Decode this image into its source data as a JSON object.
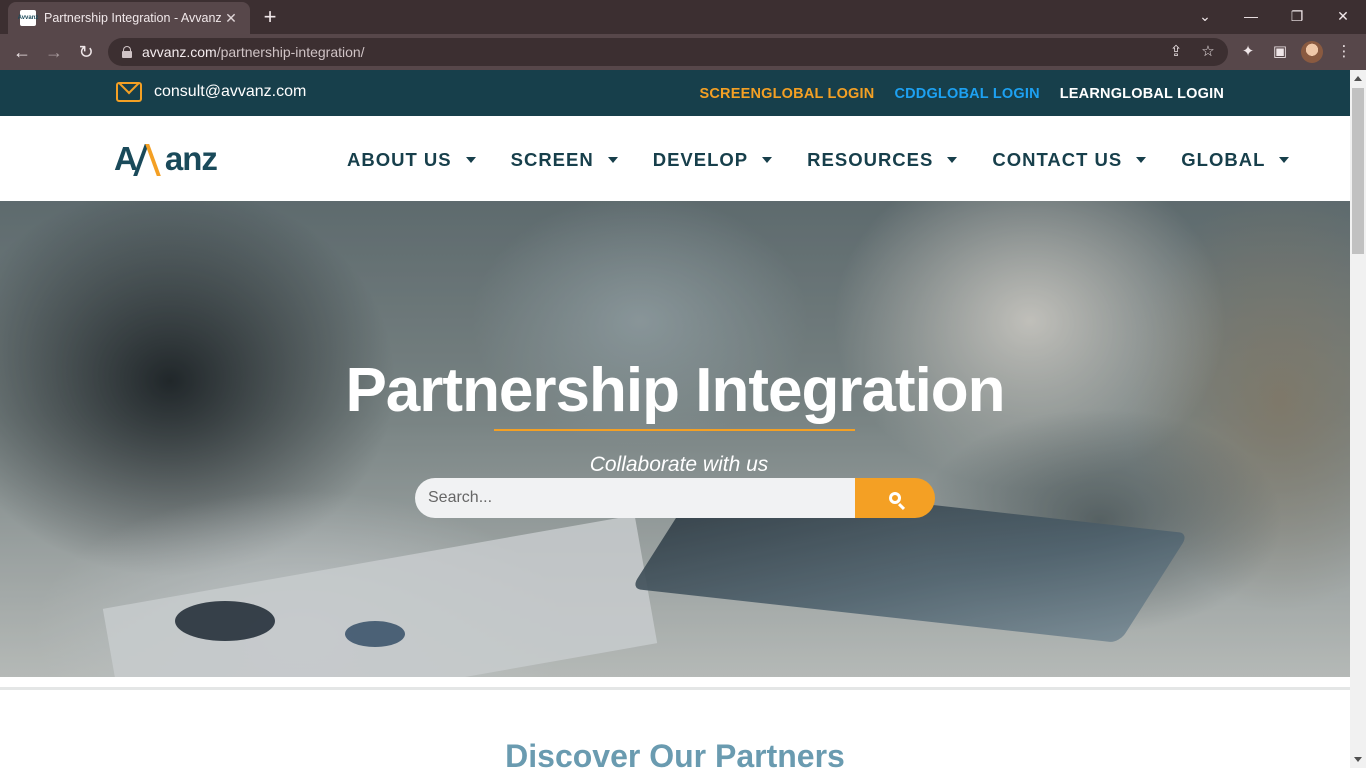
{
  "browser": {
    "tab_title": "Partnership Integration - Avvanz",
    "favicon_text": "Avvanz",
    "url_host": "avvanz.com",
    "url_path": "/partnership-integration/"
  },
  "topbar": {
    "email": "consult@avvanz.com",
    "logins": [
      {
        "label": "SCREENGLOBAL LOGIN",
        "color": "#f4a024"
      },
      {
        "label": "CDDGLOBAL LOGIN",
        "color": "#1da1f2"
      },
      {
        "label": "LEARNGLOBAL LOGIN",
        "color": "#ffffff"
      }
    ]
  },
  "header": {
    "logo_left": "A",
    "logo_right": "anz",
    "nav": [
      {
        "label": "ABOUT US"
      },
      {
        "label": "SCREEN"
      },
      {
        "label": "DEVELOP"
      },
      {
        "label": "RESOURCES"
      },
      {
        "label": "CONTACT US"
      },
      {
        "label": "GLOBAL"
      }
    ]
  },
  "hero": {
    "title": "Partnership Integration",
    "subtitle": "Collaborate with us",
    "search_placeholder": "Search..."
  },
  "section": {
    "title": "Discover Our Partners"
  },
  "colors": {
    "brand_dark": "#173f4b",
    "accent": "#f4a024",
    "section_title": "#6a9bb0"
  }
}
